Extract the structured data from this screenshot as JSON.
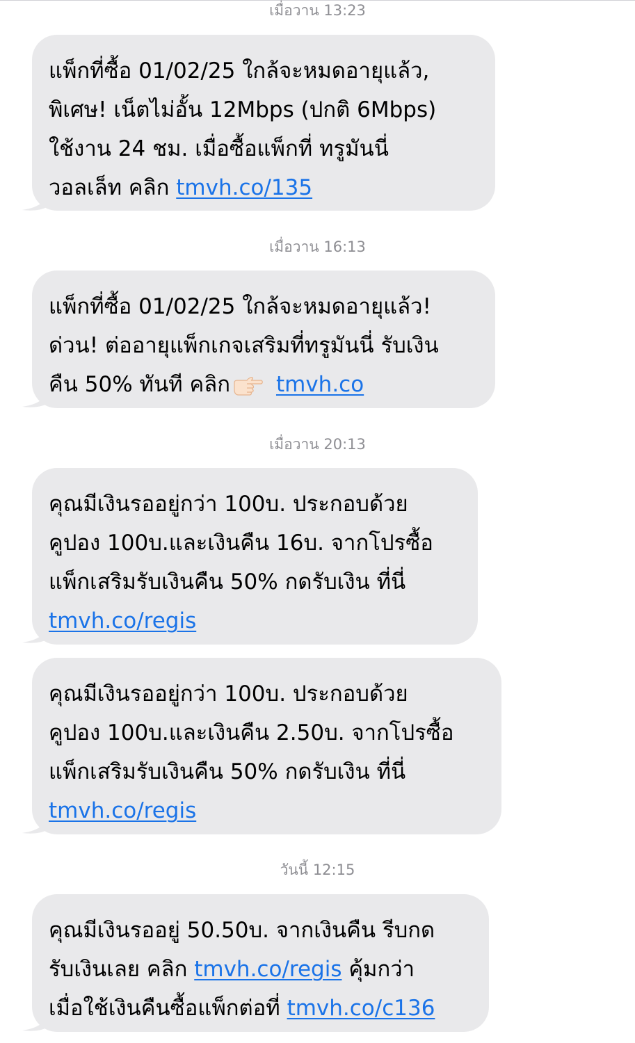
{
  "conversation": {
    "messages": [
      {
        "timestamp": "เมื่อวาน 13:23",
        "lines": [
          {
            "text": "แพ็กที่ซื้อ 01/02/25 ใกล้จะหมดอายุแล้ว,"
          },
          {
            "text": "พิเศษ! เน็ตไม่อั้น 12Mbps (ปกติ 6Mbps)"
          },
          {
            "text": "ใช้งาน 24 ชม. เมื่อซื้อแพ็กที่ ทรูมันนี่"
          },
          {
            "text": "วอลเล็ท คลิก ",
            "link": "tmvh.co/135"
          }
        ]
      },
      {
        "timestamp": "เมื่อวาน 16:13",
        "lines": [
          {
            "text": "แพ็กที่ซื้อ 01/02/25 ใกล้จะหมดอายุแล้ว!"
          },
          {
            "text": "ด่วน! ต่ออายุแพ็กเกจเสริมที่ทรูมันนี่ รับเงิน"
          },
          {
            "text": "คืน 50% ทันที คลิก",
            "emoji": "pointing-right-hand-icon",
            "link": "tmvh.co"
          }
        ]
      },
      {
        "timestamp": "เมื่อวาน 20:13",
        "lines": [
          {
            "text": "คุณมีเงินรออยู่กว่า 100บ. ประกอบด้วย"
          },
          {
            "text": "คูปอง 100บ.และเงินคืน 16บ. จากโปรซื้อ"
          },
          {
            "text": "แพ็กเสริมรับเงินคืน 50% กดรับเงิน ที่นี่"
          },
          {
            "text": "",
            "link": "tmvh.co/regis"
          }
        ]
      },
      {
        "timestamp": "",
        "lines": [
          {
            "text": "คุณมีเงินรออยู่กว่า 100บ. ประกอบด้วย"
          },
          {
            "text": "คูปอง 100บ.และเงินคืน 2.50บ. จากโปรซื้อ"
          },
          {
            "text": "แพ็กเสริมรับเงินคืน 50% กดรับเงิน ที่นี่"
          },
          {
            "text": "",
            "link": "tmvh.co/regis"
          }
        ]
      },
      {
        "timestamp": "วันนี้ 12:15",
        "lines": [
          {
            "text": "คุณมีเงินรออยู่ 50.50บ. จากเงินคืน รีบกด"
          },
          {
            "text": "รับเงินเลย คลิก ",
            "link": "tmvh.co/regis",
            "after": " คุ้มกว่า"
          },
          {
            "text": "เมื่อใช้เงินคืนซื้อแพ็กต่อที่ ",
            "link": "tmvh.co/c136"
          }
        ]
      }
    ]
  },
  "colors": {
    "bubble_background": "#e9e9eb",
    "link": "#1a73e8",
    "timestamp": "#8e8e93",
    "page_background": "#ffffff"
  }
}
